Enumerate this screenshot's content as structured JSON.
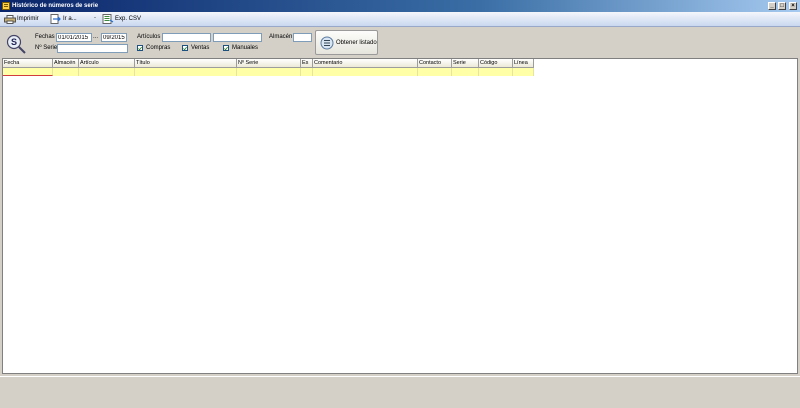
{
  "window": {
    "title": "Histórico de números de serie",
    "controls": [
      "_",
      "□",
      "×"
    ]
  },
  "toolbar": {
    "print_label": "Imprimir",
    "goto_label": "Ir a...",
    "export_label": "Exp. CSV",
    "separator": "-"
  },
  "filters": {
    "dates_label": "Fechas",
    "date_from": "01/01/2015",
    "date_to": "09/2015",
    "date_between": "...",
    "serial_label": "Nº Serie",
    "serial_value": "",
    "articles_label": "Artículos",
    "article_from": "",
    "article_to": "",
    "warehouse_label": "Almacén",
    "warehouse_value": "",
    "checks": [
      {
        "label": "Compras",
        "checked": true
      },
      {
        "label": "Ventas",
        "checked": true
      },
      {
        "label": "Manuales",
        "checked": true
      }
    ],
    "get_button_label": "Obtener listado"
  },
  "grid": {
    "columns": [
      "Fecha",
      "Almacén",
      "Artículo",
      "Título",
      "Nº Serie",
      "Es",
      "Comentario",
      "Contacto",
      "Serie",
      "Código",
      "Línea"
    ]
  },
  "colors": {
    "title_bar": "#0a246a",
    "grid_row_highlight": "#ffffa8",
    "selection_border": "#d23c3c"
  },
  "icons": {
    "print": "printer-icon",
    "goto": "goto-icon",
    "export": "csv-export-icon",
    "logo": "serial-search-icon",
    "get": "list-icon"
  }
}
